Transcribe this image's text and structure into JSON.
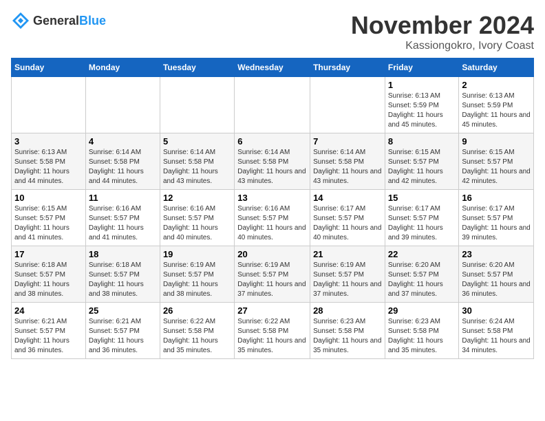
{
  "logo": {
    "text_general": "General",
    "text_blue": "Blue"
  },
  "title": "November 2024",
  "subtitle": "Kassiongokro, Ivory Coast",
  "days_of_week": [
    "Sunday",
    "Monday",
    "Tuesday",
    "Wednesday",
    "Thursday",
    "Friday",
    "Saturday"
  ],
  "weeks": [
    [
      {
        "day": "",
        "info": ""
      },
      {
        "day": "",
        "info": ""
      },
      {
        "day": "",
        "info": ""
      },
      {
        "day": "",
        "info": ""
      },
      {
        "day": "",
        "info": ""
      },
      {
        "day": "1",
        "info": "Sunrise: 6:13 AM\nSunset: 5:59 PM\nDaylight: 11 hours and 45 minutes."
      },
      {
        "day": "2",
        "info": "Sunrise: 6:13 AM\nSunset: 5:59 PM\nDaylight: 11 hours and 45 minutes."
      }
    ],
    [
      {
        "day": "3",
        "info": "Sunrise: 6:13 AM\nSunset: 5:58 PM\nDaylight: 11 hours and 44 minutes."
      },
      {
        "day": "4",
        "info": "Sunrise: 6:14 AM\nSunset: 5:58 PM\nDaylight: 11 hours and 44 minutes."
      },
      {
        "day": "5",
        "info": "Sunrise: 6:14 AM\nSunset: 5:58 PM\nDaylight: 11 hours and 43 minutes."
      },
      {
        "day": "6",
        "info": "Sunrise: 6:14 AM\nSunset: 5:58 PM\nDaylight: 11 hours and 43 minutes."
      },
      {
        "day": "7",
        "info": "Sunrise: 6:14 AM\nSunset: 5:58 PM\nDaylight: 11 hours and 43 minutes."
      },
      {
        "day": "8",
        "info": "Sunrise: 6:15 AM\nSunset: 5:57 PM\nDaylight: 11 hours and 42 minutes."
      },
      {
        "day": "9",
        "info": "Sunrise: 6:15 AM\nSunset: 5:57 PM\nDaylight: 11 hours and 42 minutes."
      }
    ],
    [
      {
        "day": "10",
        "info": "Sunrise: 6:15 AM\nSunset: 5:57 PM\nDaylight: 11 hours and 41 minutes."
      },
      {
        "day": "11",
        "info": "Sunrise: 6:16 AM\nSunset: 5:57 PM\nDaylight: 11 hours and 41 minutes."
      },
      {
        "day": "12",
        "info": "Sunrise: 6:16 AM\nSunset: 5:57 PM\nDaylight: 11 hours and 40 minutes."
      },
      {
        "day": "13",
        "info": "Sunrise: 6:16 AM\nSunset: 5:57 PM\nDaylight: 11 hours and 40 minutes."
      },
      {
        "day": "14",
        "info": "Sunrise: 6:17 AM\nSunset: 5:57 PM\nDaylight: 11 hours and 40 minutes."
      },
      {
        "day": "15",
        "info": "Sunrise: 6:17 AM\nSunset: 5:57 PM\nDaylight: 11 hours and 39 minutes."
      },
      {
        "day": "16",
        "info": "Sunrise: 6:17 AM\nSunset: 5:57 PM\nDaylight: 11 hours and 39 minutes."
      }
    ],
    [
      {
        "day": "17",
        "info": "Sunrise: 6:18 AM\nSunset: 5:57 PM\nDaylight: 11 hours and 38 minutes."
      },
      {
        "day": "18",
        "info": "Sunrise: 6:18 AM\nSunset: 5:57 PM\nDaylight: 11 hours and 38 minutes."
      },
      {
        "day": "19",
        "info": "Sunrise: 6:19 AM\nSunset: 5:57 PM\nDaylight: 11 hours and 38 minutes."
      },
      {
        "day": "20",
        "info": "Sunrise: 6:19 AM\nSunset: 5:57 PM\nDaylight: 11 hours and 37 minutes."
      },
      {
        "day": "21",
        "info": "Sunrise: 6:19 AM\nSunset: 5:57 PM\nDaylight: 11 hours and 37 minutes."
      },
      {
        "day": "22",
        "info": "Sunrise: 6:20 AM\nSunset: 5:57 PM\nDaylight: 11 hours and 37 minutes."
      },
      {
        "day": "23",
        "info": "Sunrise: 6:20 AM\nSunset: 5:57 PM\nDaylight: 11 hours and 36 minutes."
      }
    ],
    [
      {
        "day": "24",
        "info": "Sunrise: 6:21 AM\nSunset: 5:57 PM\nDaylight: 11 hours and 36 minutes."
      },
      {
        "day": "25",
        "info": "Sunrise: 6:21 AM\nSunset: 5:57 PM\nDaylight: 11 hours and 36 minutes."
      },
      {
        "day": "26",
        "info": "Sunrise: 6:22 AM\nSunset: 5:58 PM\nDaylight: 11 hours and 35 minutes."
      },
      {
        "day": "27",
        "info": "Sunrise: 6:22 AM\nSunset: 5:58 PM\nDaylight: 11 hours and 35 minutes."
      },
      {
        "day": "28",
        "info": "Sunrise: 6:23 AM\nSunset: 5:58 PM\nDaylight: 11 hours and 35 minutes."
      },
      {
        "day": "29",
        "info": "Sunrise: 6:23 AM\nSunset: 5:58 PM\nDaylight: 11 hours and 35 minutes."
      },
      {
        "day": "30",
        "info": "Sunrise: 6:24 AM\nSunset: 5:58 PM\nDaylight: 11 hours and 34 minutes."
      }
    ]
  ]
}
